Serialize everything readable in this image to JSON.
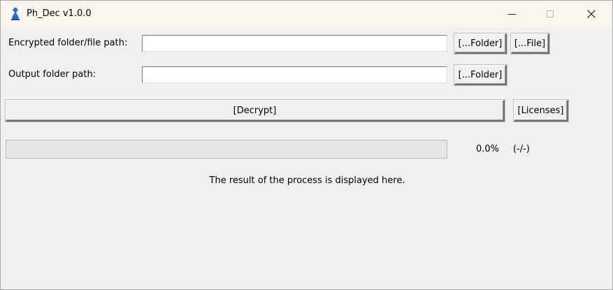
{
  "window": {
    "title": "Ph_Dec v1.0.0",
    "app_icon": "chess-piece-icon",
    "controls": {
      "minimize": "minimize-icon",
      "maximize": "maximize-icon",
      "close": "close-icon"
    }
  },
  "form": {
    "encrypted_path_label": "Encrypted folder/file path:",
    "encrypted_path_value": "",
    "output_path_label": "Output folder path:",
    "output_path_value": "",
    "browse_folder_label": "[...Folder]",
    "browse_file_label": "[...File]",
    "output_browse_folder_label": "[...Folder]"
  },
  "actions": {
    "decrypt_label": "[Decrypt]",
    "licenses_label": "[Licenses]"
  },
  "progress": {
    "percent_text": "0.0%",
    "count_text": "(-/-)",
    "fraction": 0.0
  },
  "status": {
    "result_text": "The result of the process is displayed here."
  },
  "colors": {
    "titlebar": "#faf5ee",
    "window_bg": "#f0f0f0",
    "progress_trough": "#e6e6e6",
    "icon_blue": "#2a6fc9"
  }
}
